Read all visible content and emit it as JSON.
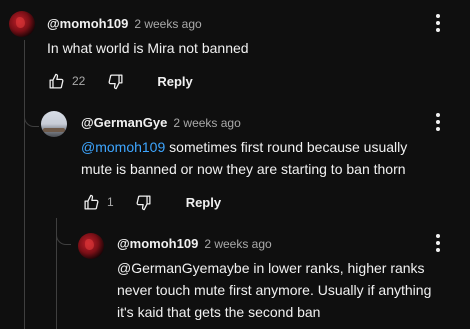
{
  "comments": [
    {
      "author": "@momoh109",
      "time": "2 weeks ago",
      "text": "In what world is Mira not banned",
      "likes": "22",
      "reply_label": "Reply",
      "avatar": "red-swirl-avatar"
    },
    {
      "author": "@GermanGye",
      "time": "2 weeks ago",
      "mention": "@momoh109",
      "text_line1": " sometimes first round because usually",
      "text_line2": "mute is banned or now they are starting to ban thorn",
      "likes": "1",
      "reply_label": "Reply",
      "avatar": "sky-landscape-avatar"
    },
    {
      "author": "@momoh109",
      "time": "2 weeks ago",
      "text_line1": "@GermanGyemaybe in lower ranks, higher ranks",
      "text_line2": "never touch mute first anymore. Usually if anything",
      "text_line3": "it's kaid that gets the second ban",
      "avatar": "red-swirl-avatar"
    }
  ],
  "icons": {
    "like": "thumbs-up-icon",
    "dislike": "thumbs-down-icon",
    "menu": "more-vert-icon"
  }
}
